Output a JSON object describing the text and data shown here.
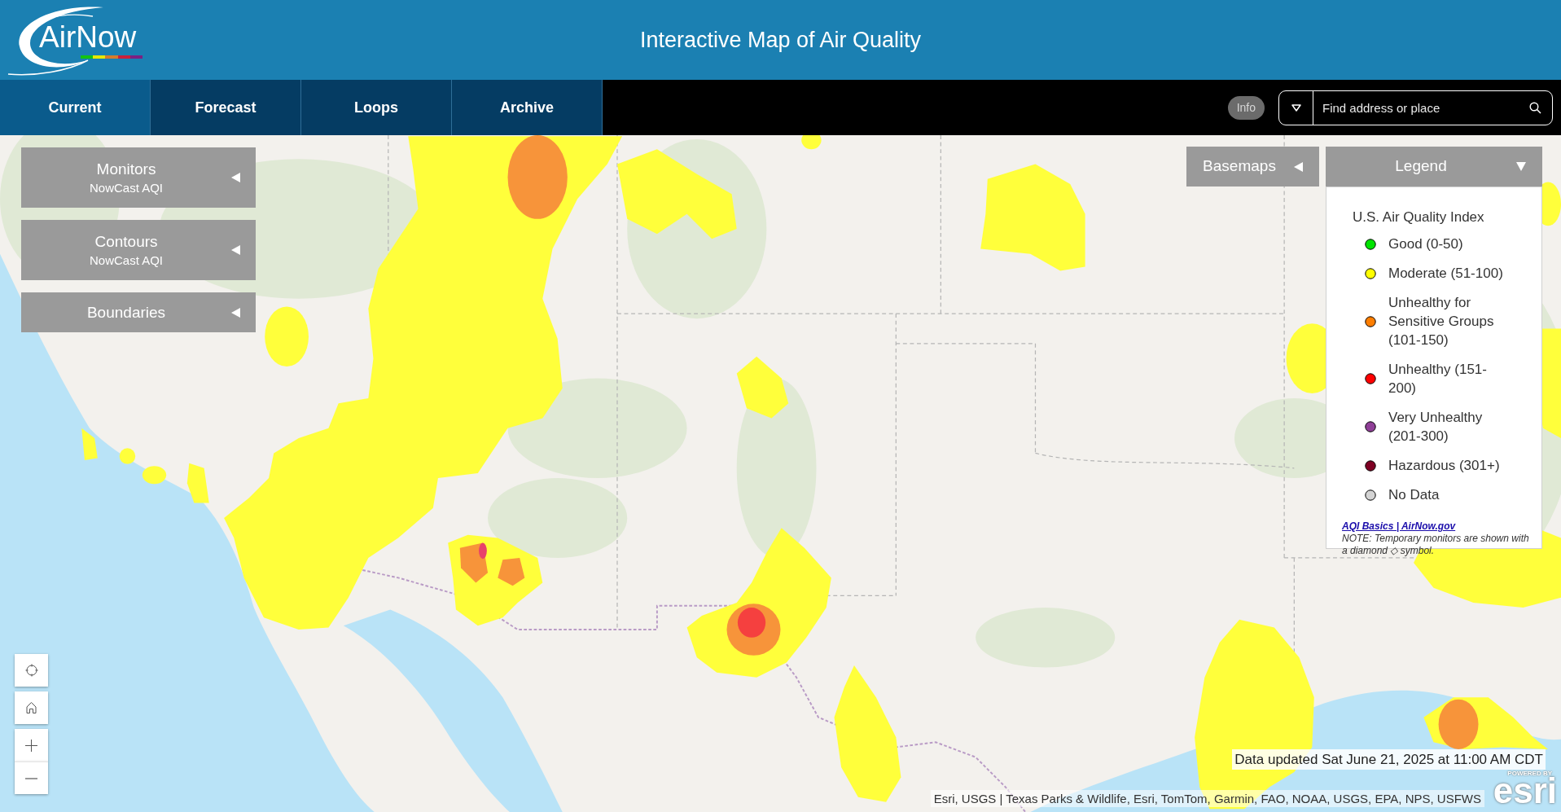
{
  "header": {
    "logo": "AirNow",
    "title": "Interactive Map of Air Quality"
  },
  "nav": {
    "tabs": [
      {
        "label": "Current",
        "selected": true
      },
      {
        "label": "Forecast",
        "selected": false
      },
      {
        "label": "Loops",
        "selected": false
      },
      {
        "label": "Archive",
        "selected": false
      }
    ],
    "info_button": "Info",
    "search": {
      "placeholder": "Find address or place"
    }
  },
  "layer_panels": [
    {
      "title": "Monitors",
      "subtitle": "NowCast AQI",
      "expanded": false
    },
    {
      "title": "Contours",
      "subtitle": "NowCast AQI",
      "expanded": false
    },
    {
      "title": "Boundaries",
      "expanded": false
    }
  ],
  "basemaps": {
    "label": "Basemaps",
    "expanded": false
  },
  "legend": {
    "title": "Legend",
    "expanded": true,
    "heading": "U.S. Air Quality Index",
    "items": [
      {
        "label": "Good (0-50)",
        "color": "#00e400"
      },
      {
        "label": "Moderate (51-100)",
        "color": "#ffff00"
      },
      {
        "label": "Unhealthy for Sensitive Groups (101-150)",
        "color": "#ff7e00"
      },
      {
        "label": "Unhealthy (151-200)",
        "color": "#ff0000"
      },
      {
        "label": "Very Unhealthy (201-300)",
        "color": "#8f3f97"
      },
      {
        "label": "Hazardous (301+)",
        "color": "#7e0023"
      },
      {
        "label": "No Data",
        "color": "#d3d3d3"
      }
    ],
    "link": "AQI Basics | AirNow.gov",
    "note": "NOTE: Temporary monitors are shown with a diamond ◇ symbol."
  },
  "data_updated": "Data updated Sat June 21, 2025 at 11:00 AM CDT",
  "attribution": "Esri, USGS | Texas Parks & Wildlife, Esri, TomTom, Garmin, FAO, NOAA, USGS, EPA, NPS, USFWS",
  "esri_logo": {
    "tagline": "POWERED BY",
    "wordmark": "esri"
  }
}
